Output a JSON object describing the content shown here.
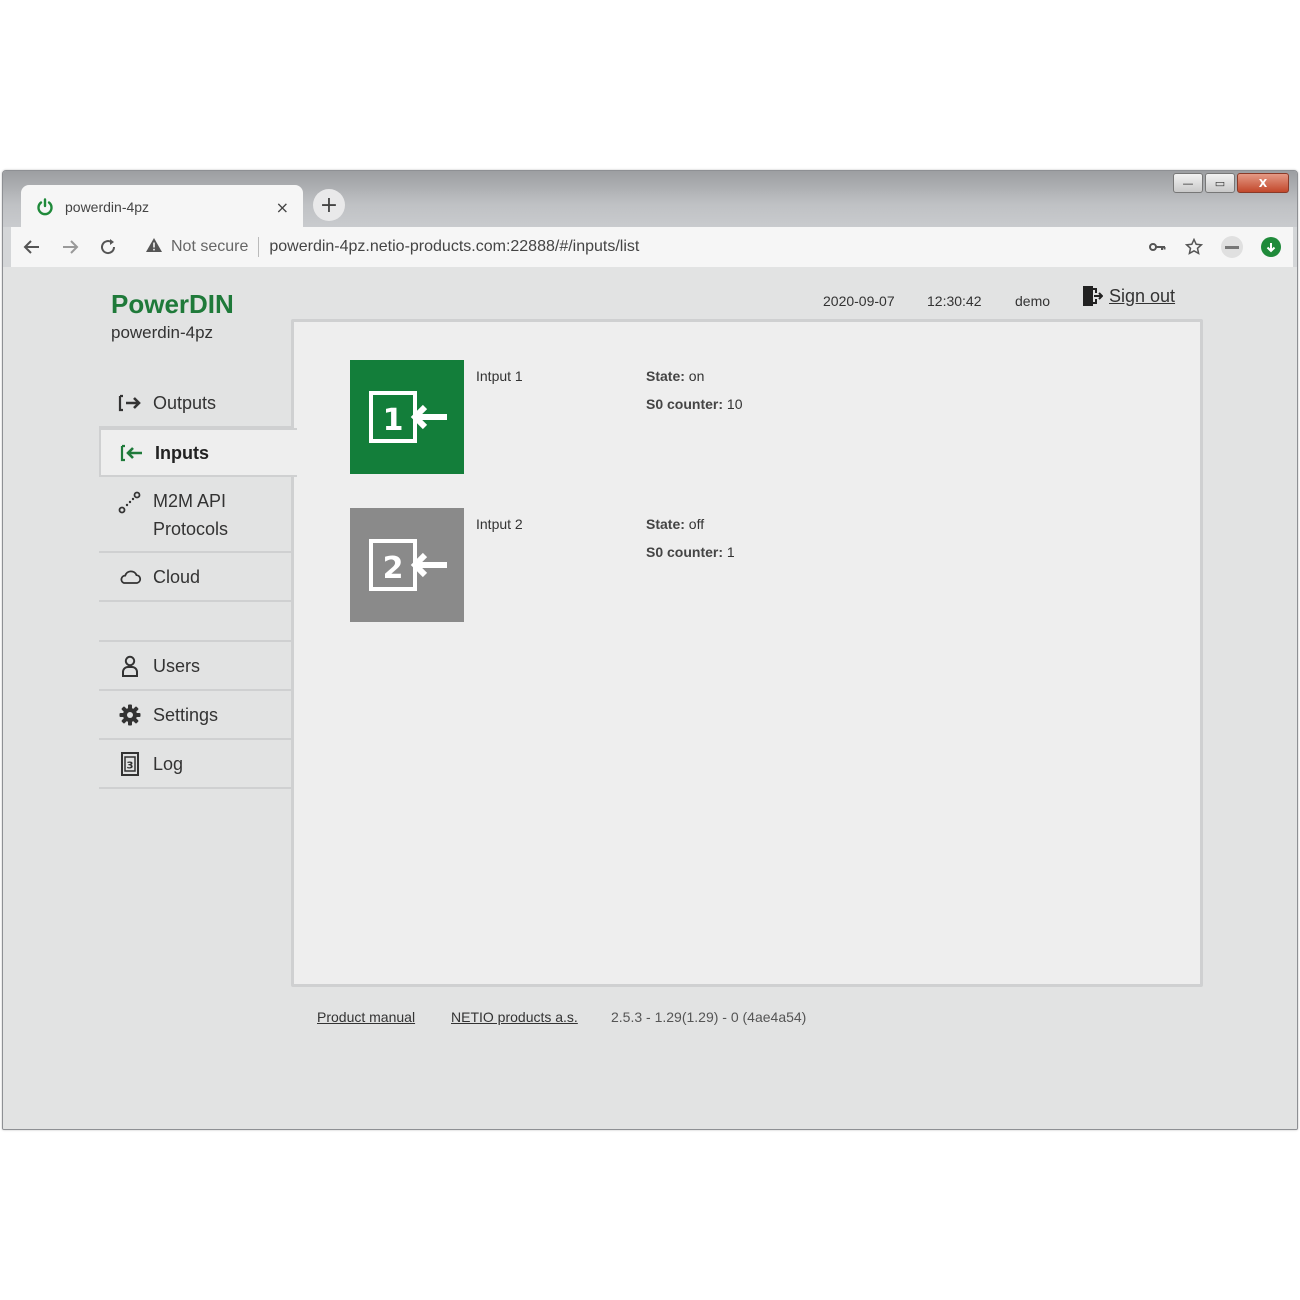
{
  "browser": {
    "tab_title": "powerdin-4pz",
    "tab_close": "×",
    "new_tab": "+",
    "not_secure": "Not secure",
    "url": "powerdin-4pz.netio-products.com:22888/#/inputs/list",
    "window_controls": {
      "minimize": "—",
      "maximize": "▭",
      "close": "X"
    },
    "icons": [
      "back-arrow-icon",
      "forward-arrow-icon",
      "reload-icon",
      "warning-icon",
      "key-icon",
      "star-icon",
      "extension-icon",
      "extension-green-icon"
    ]
  },
  "header": {
    "brand": "PowerDIN",
    "hostname": "powerdin-4pz",
    "date": "2020-09-07",
    "time": "12:30:42",
    "user": "demo",
    "sign_out": "Sign out"
  },
  "sidebar": {
    "items": [
      {
        "label": "Outputs",
        "icon": "outputs-icon"
      },
      {
        "label": "Inputs",
        "icon": "inputs-icon",
        "active": true
      },
      {
        "label": "M2M API",
        "label2": "Protocols",
        "icon": "m2m-api-icon"
      },
      {
        "label": "Cloud",
        "icon": "cloud-icon"
      },
      {
        "label": "Users",
        "icon": "user-icon"
      },
      {
        "label": "Settings",
        "icon": "gear-icon"
      },
      {
        "label": "Log",
        "icon": "log-icon"
      }
    ]
  },
  "inputs": [
    {
      "number": "1",
      "name": "Intput 1",
      "state_label": "State:",
      "state": "on",
      "counter_label": "S0 counter:",
      "counter": "10",
      "color": "#137e3a"
    },
    {
      "number": "2",
      "name": "Intput 2",
      "state_label": "State:",
      "state": "off",
      "counter_label": "S0 counter:",
      "counter": "1",
      "color": "#8a8a8a"
    }
  ],
  "footer": {
    "manual": "Product manual",
    "company": "NETIO products a.s.",
    "version": "2.5.3 - 1.29(1.29) - 0 (4ae4a54)"
  },
  "colors": {
    "brand": "#1f7a3a",
    "active_input": "#137e3a",
    "inactive_input": "#8a8a8a"
  }
}
